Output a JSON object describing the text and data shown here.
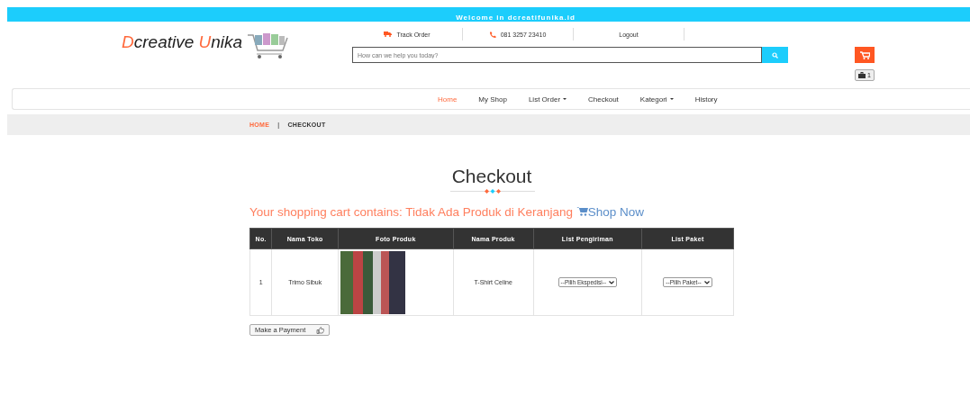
{
  "topbar": {
    "text": "Welcome in dcreatifunika.id"
  },
  "logo": {
    "parts": [
      {
        "text": "D",
        "accent": true
      },
      {
        "text": "creative ",
        "accent": false
      },
      {
        "text": "U",
        "accent": true
      },
      {
        "text": "nika",
        "accent": false
      }
    ]
  },
  "header_links": [
    {
      "kind": "track",
      "label": "Track Order"
    },
    {
      "kind": "phone",
      "label": "081 3257 23410"
    },
    {
      "kind": "plain",
      "label": "Logout"
    }
  ],
  "search": {
    "placeholder": "How can we help you today?"
  },
  "cart": {
    "count": "1"
  },
  "nav": {
    "items": [
      {
        "label": "Home",
        "selected": true,
        "dropdown": false
      },
      {
        "label": "My Shop",
        "selected": false,
        "dropdown": false
      },
      {
        "label": "List Order",
        "selected": false,
        "dropdown": true
      },
      {
        "label": "Checkout",
        "selected": false,
        "dropdown": false
      },
      {
        "label": "Kategori",
        "selected": false,
        "dropdown": true
      },
      {
        "label": "History",
        "selected": false,
        "dropdown": false
      }
    ]
  },
  "breadcrumb": {
    "separator": "|",
    "items": [
      {
        "label": "HOME",
        "current": false
      },
      {
        "label": "CHECKOUT",
        "current": true
      }
    ]
  },
  "page_title": "Checkout",
  "cart_message": {
    "text": "Your shopping cart contains: Tidak Ada Produk di Keranjang",
    "link": "Shop Now"
  },
  "table": {
    "columns": [
      "No.",
      "Nama Toko",
      "Foto Produk",
      "Nama Produk",
      "List Pengiriman",
      "List Paket"
    ],
    "rows": [
      {
        "cells": [
          {
            "kind": "text",
            "text": "1"
          },
          {
            "kind": "text",
            "text": "Trimo Sibuk"
          },
          {
            "kind": "photo"
          },
          {
            "kind": "text",
            "text": "T-Shirt Celine"
          },
          {
            "kind": "select",
            "value": "--Pilih Ekspedisi--"
          },
          {
            "kind": "select",
            "value": "--Pilih Paket--"
          }
        ]
      }
    ]
  },
  "payment_button": {
    "label": "Make a Payment"
  }
}
